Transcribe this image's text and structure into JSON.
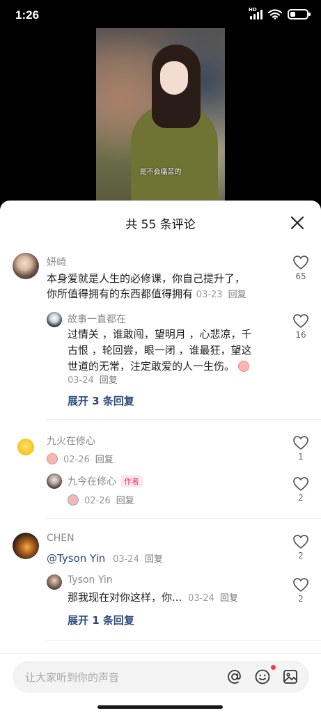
{
  "status": {
    "time": "1:26",
    "network": "HD"
  },
  "video": {
    "caption": "是不会痛苦的"
  },
  "sheet": {
    "title": "共 55 条评论"
  },
  "comments": [
    {
      "nick": "妍崎",
      "text_line1": "本身爱就是人生的必修课，你自己提升了，",
      "text_line2": "你所值得拥有的东西都值得拥有",
      "date": "03-23",
      "reply": "回复",
      "likes": "65",
      "sub": {
        "nick": "故事一直都在",
        "line1": "过情关 ，谁敢闯，望明月 ，心悲凉，千",
        "line2": "古恨 ，轮回尝，眼一闭 ，谁最狂，望这",
        "line3": "世道的无常，注定敢爱的人一生伤。",
        "date": "03-24",
        "reply": "回复",
        "likes": "16"
      },
      "expand": "展开 3 条回复"
    },
    {
      "nick": "九火在修心",
      "date": "02-26",
      "reply": "回复",
      "likes": "1",
      "sub": {
        "nick": "九今在修心",
        "tag": "作者",
        "date": "02-26",
        "reply": "回复",
        "likes": "2"
      }
    },
    {
      "nick": "CHEN",
      "text": "@Tyson Yin",
      "date": "03-24",
      "reply": "回复",
      "likes": "2",
      "sub": {
        "nick": "Tyson Yin",
        "text": "那我现在对你这样，你...",
        "date": "03-24",
        "reply": "回复",
        "likes": "2"
      },
      "expand": "展开 1 条回复"
    }
  ],
  "input": {
    "placeholder": "让大家听到你的声音"
  },
  "colors": {
    "accent_link": "#2c4a7a",
    "author_tag": "#e33b5e",
    "notify_dot": "#f23a45"
  }
}
